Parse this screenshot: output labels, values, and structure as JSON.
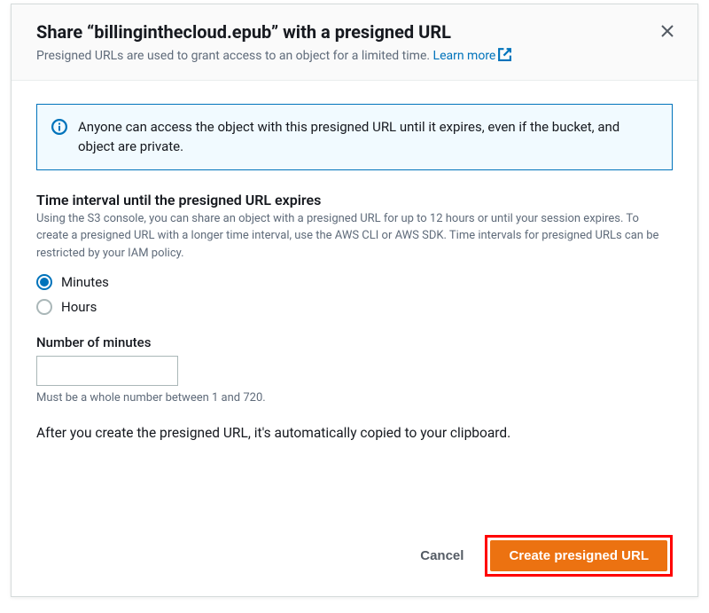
{
  "header": {
    "title": "Share “billinginthecloud.epub” with a presigned URL",
    "subtitle_prefix": "Presigned URLs are used to grant access to an object for a limited time. ",
    "learn_more": "Learn more"
  },
  "info": {
    "message": "Anyone can access the object with this presigned URL until it expires, even if the bucket, and object are private."
  },
  "interval": {
    "heading": "Time interval until the presigned URL expires",
    "description": "Using the S3 console, you can share an object with a presigned URL for up to 12 hours or until your session expires. To create a presigned URL with a longer time interval, use the AWS CLI or AWS SDK. Time intervals for presigned URLs can be restricted by your IAM policy.",
    "options": {
      "minutes": "Minutes",
      "hours": "Hours"
    },
    "selected": "minutes"
  },
  "number": {
    "label": "Number of minutes",
    "value": "",
    "hint": "Must be a whole number between 1 and 720."
  },
  "post_note": "After you create the presigned URL, it's automatically copied to your clipboard.",
  "footer": {
    "cancel": "Cancel",
    "create": "Create presigned URL"
  }
}
